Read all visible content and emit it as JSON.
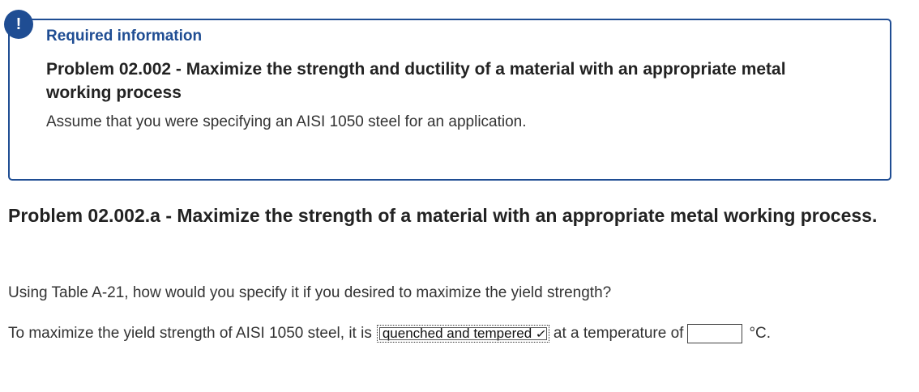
{
  "alert": {
    "icon": "exclamation-icon",
    "symbol": "!",
    "color": "#1f4d93"
  },
  "info_box": {
    "heading": "Required information",
    "title": "Problem 02.002 - Maximize the strength and ductility of a material with an appropriate metal working process",
    "text": "Assume that you were specifying an AISI 1050 steel for an application."
  },
  "part": {
    "title": "Problem 02.002.a - Maximize the strength of a material with an appropriate metal working process.",
    "question": "Using Table A-21, how would you specify it if you desired to maximize the yield strength?",
    "answer_prefix": "To maximize the yield strength of AISI 1050 steel, it is",
    "dropdown_selected": "quenched and tempered",
    "dropdown_icon": "chevron-down-icon",
    "answer_middle": "at a temperature of",
    "temperature_value": "",
    "unit": "°C."
  }
}
